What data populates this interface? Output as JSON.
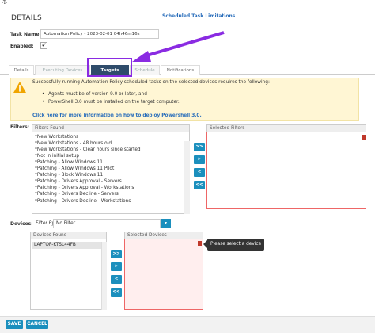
{
  "corner_text": "-T-",
  "page": {
    "title": "DETAILS",
    "scheduled_link": "Scheduled Task Limitations",
    "task_name_label": "Task Name:",
    "task_name_value": "Automation Policy - 2023-02-01 04h46m16s",
    "enabled_label": "Enabled:",
    "enabled_check": "✔"
  },
  "tabs": [
    {
      "label": "Details",
      "state": "normal"
    },
    {
      "label": "Executing Devices",
      "state": "disabled"
    },
    {
      "label": "Targets",
      "state": "active"
    },
    {
      "label": "Schedule",
      "state": "disabled"
    },
    {
      "label": "Notifications",
      "state": "normal"
    }
  ],
  "warning": {
    "intro": "Successfully running Automation Policy scheduled tasks on the selected devices requires the following:",
    "bullets": [
      "Agents must be of version 9.0 or later, and",
      "PowerShell 3.0 must be installed on the target computer."
    ],
    "link": "Click here for more information on how to deploy Powershell 3.0."
  },
  "filters": {
    "label": "Filters:",
    "found_header": "Filters Found",
    "selected_header": "Selected Filters",
    "items": [
      "*New Workstations",
      "*New Workstations - 48 hours old",
      "*New Workstations - Clear hours since started",
      "*Not in initial setup",
      "*Patching - Allow Windows 11",
      "*Patching - Allow Windows 11 Pilot",
      "*Patching - Block Windows 11",
      "*Patching - Drivers Approval - Servers",
      "*Patching - Drivers Approval - Workstations",
      "*Patching - Drivers Decline - Servers",
      "*Patching - Drivers Decline - Workstations"
    ],
    "buttons": [
      ">>",
      ">",
      "<",
      "<<"
    ]
  },
  "devices": {
    "label": "Devices:",
    "filter_by_label": "Filter By:",
    "filter_value": "No Filter",
    "filter_button": "▾",
    "found_header": "Devices Found",
    "selected_header": "Selected Devices",
    "items": [
      "LAPTOP-KTSL44FB"
    ],
    "buttons": [
      ">>",
      ">",
      "<",
      "<<"
    ],
    "tooltip": "Please select a device"
  },
  "footer": {
    "save": "SAVE",
    "cancel": "CANCEL"
  },
  "colors": {
    "accent": "#1b8fbd",
    "active_tab": "#2f4c6b",
    "highlight": "#8a2be2",
    "warning_bg": "#fff6d4",
    "error_border": "#e66666"
  }
}
